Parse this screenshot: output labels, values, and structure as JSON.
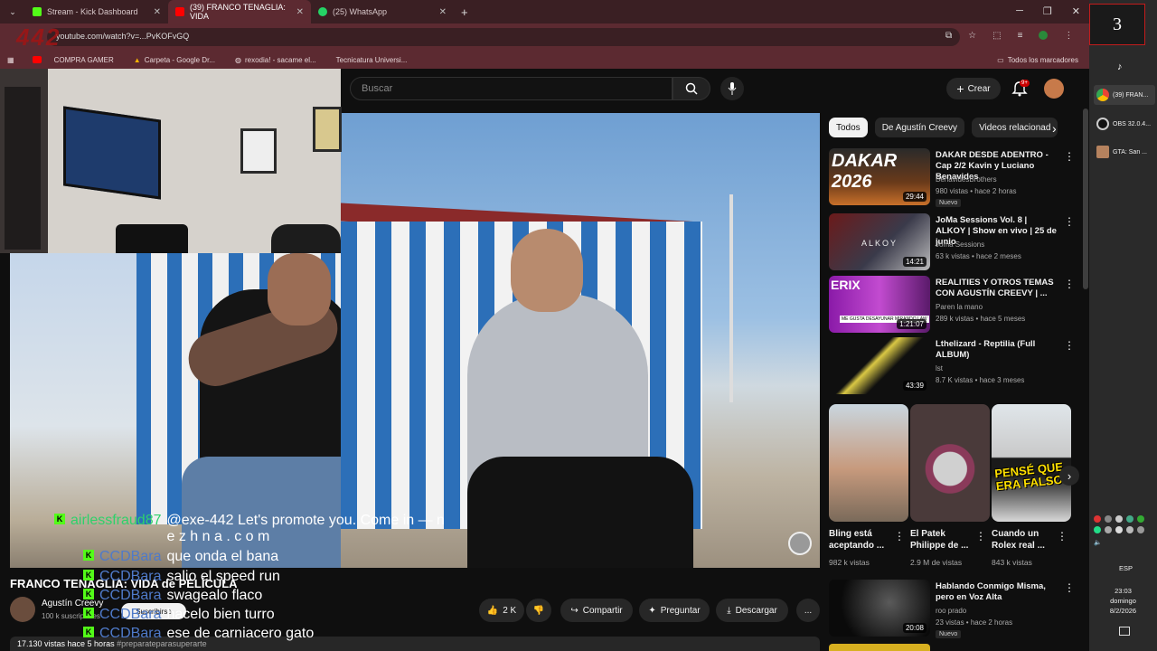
{
  "browser": {
    "tabs": [
      {
        "label": "Stream - Kick Dashboard",
        "icon": "kick-icon",
        "color": "#53fc18"
      },
      {
        "label": "(39) FRANCO TENAGLIA: VIDA",
        "icon": "youtube-icon",
        "color": "#ff0000"
      },
      {
        "label": "(25) WhatsApp",
        "icon": "whatsapp-icon",
        "color": "#25d366"
      }
    ],
    "new_tab": "+",
    "address": "youtube.com/watch?v=...PvKOFvGQ",
    "bookmarks": [
      {
        "label": "COMPRA GAMER"
      },
      {
        "label": "Carpeta - Google Dr..."
      },
      {
        "label": "rexodia! - sacame el..."
      },
      {
        "label": "Tecnicatura Universi..."
      }
    ],
    "all_bookmarks": "Todos los marcadores"
  },
  "youtube": {
    "search_placeholder": "Buscar",
    "create_label": "Crear",
    "notifications_badge": "9+",
    "video_title": "FRANCO TENAGLIA: VIDA de PELÍCULA",
    "channel_name": "Agustín Creevy",
    "subscribers": "100 k suscriptores",
    "subscribe_label": "Suscribirse",
    "likes": "2 K",
    "share_label": "Compartir",
    "ask_label": "Preguntar",
    "download_label": "Descargar",
    "more_label": "...",
    "views_line": "17.130 vistas  hace 5 horas",
    "hashtag": "#preparateparasuperarte",
    "chips": [
      {
        "label": "Todos",
        "active": true
      },
      {
        "label": "De Agustín Creevy",
        "active": false
      },
      {
        "label": "Videos relacionad",
        "active": false
      }
    ],
    "recommendations": [
      {
        "title": "DAKAR DESDE ADENTRO - Cap 2/2 Kavin y Luciano Benavides",
        "channel": "BenavidesBrothers",
        "meta": "980 vistas • hace 2 horas",
        "duration": "29:44",
        "badge": "Nuevo"
      },
      {
        "title": "JoMa Sessions Vol. 8 | ALKOY | Show en vivo | 25 de junio",
        "channel": "Joma Sessions",
        "meta": "63 k vistas • hace 2 meses",
        "duration": "14:21",
        "badge": ""
      },
      {
        "title": "REALITIES Y OTROS TEMAS CON AGUSTÍN CREEVY | ...",
        "channel": "Paren la mano",
        "meta": "289 k vistas • hace 5 meses",
        "duration": "1:21:07",
        "badge": ""
      },
      {
        "title": "Lthelizard - Reptilia (Full ALBUM)",
        "channel": "lst",
        "meta": "8.7 K vistas • hace 3 meses",
        "duration": "43:39",
        "badge": ""
      }
    ],
    "shorts": [
      {
        "title": "Bling está aceptando ...",
        "views": "982 k vistas"
      },
      {
        "title": "El Patek Philippe de ...",
        "views": "2.9 M de vistas"
      },
      {
        "title": "Cuando un Rolex real ...",
        "views": "843 k vistas"
      }
    ],
    "short_overlay": "PENSÉ QUE ERA FALSO",
    "last_rec": {
      "title": "Hablando Conmigo Misma, pero en Voz Alta",
      "channel": "roo prado",
      "meta": "23 vistas • hace 2 horas",
      "duration": "20:08",
      "badge": "Nuevo"
    },
    "thumb_texts": {
      "dakar": "DAKAR 2026",
      "alkoy": "ALKOY",
      "realities": "ERIX",
      "realities_caption": "ME GUSTA DESAYUNAR MIRANDO LAW"
    }
  },
  "chat": [
    {
      "user": "airlessfraud87",
      "text": "@exe-442 Let's promote you. Come in — n",
      "text2": "e z h n a . c o m",
      "first": true
    },
    {
      "user": "CCDBara",
      "text": "que onda el bana"
    },
    {
      "user": "CCDBara",
      "text": "salio el speed run"
    },
    {
      "user": "CCDBara",
      "text": "swagealo flaco"
    },
    {
      "user": "CCDBara",
      "text": "hacelo bien turro"
    },
    {
      "user": "CCDBara",
      "text": "ese de carniacero gato"
    }
  ],
  "taskbar": {
    "widget_number": "3",
    "items": [
      {
        "label": "(39) FRAN...",
        "active": true
      },
      {
        "label": "OBS 32.0.4...",
        "active": false
      },
      {
        "label": "GTA: San ...",
        "active": false
      }
    ],
    "language": "ESP",
    "time": "23:03",
    "day": "domingo",
    "date": "8/2/2026"
  },
  "stream_logo": "442"
}
